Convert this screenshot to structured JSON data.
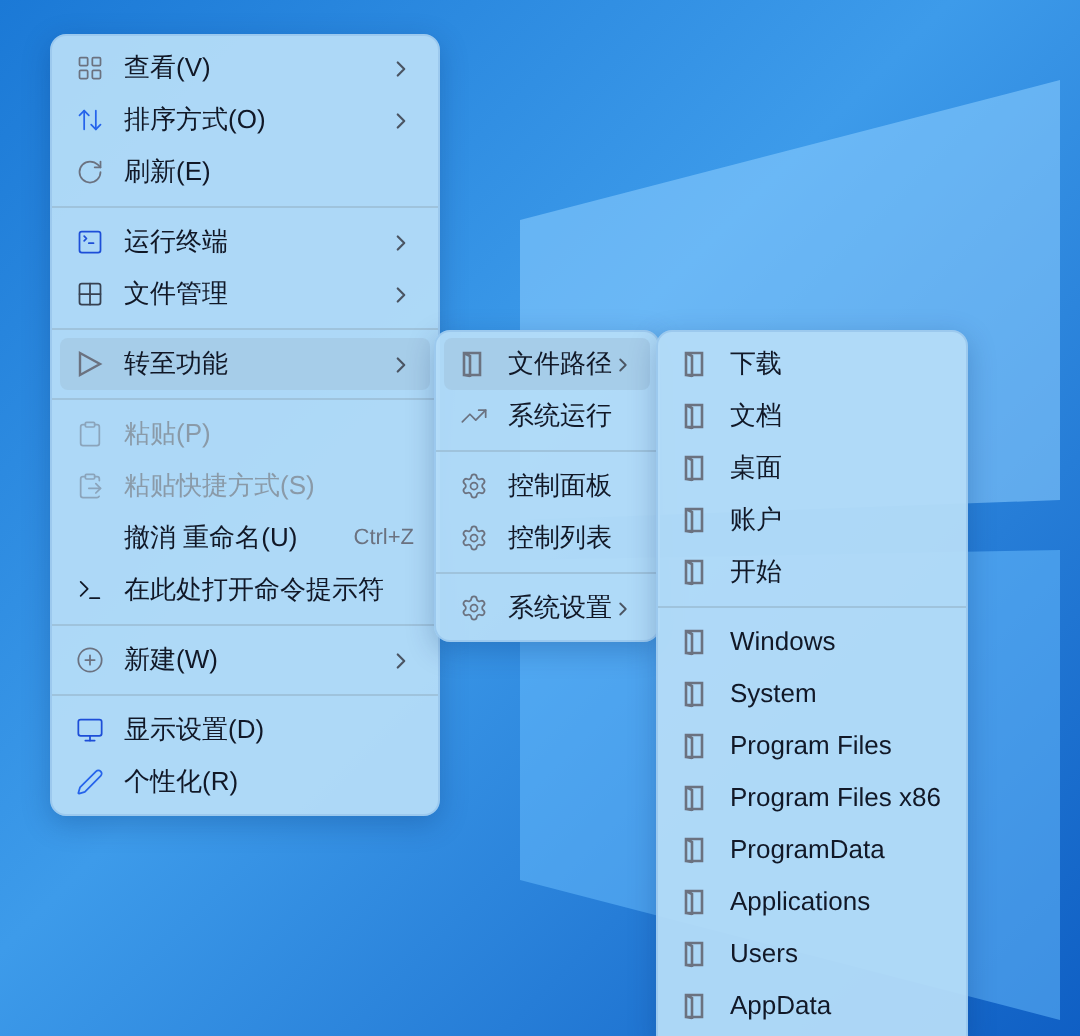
{
  "main_menu": {
    "items": [
      {
        "kind": "item",
        "label": "查看(V)",
        "has_submenu": true,
        "disabled": false,
        "selected": false
      },
      {
        "kind": "item",
        "label": "排序方式(O)",
        "has_submenu": true,
        "disabled": false,
        "selected": false
      },
      {
        "kind": "item",
        "label": "刷新(E)",
        "has_submenu": false,
        "disabled": false,
        "selected": false
      },
      {
        "kind": "separator"
      },
      {
        "kind": "item",
        "label": "运行终端",
        "has_submenu": true,
        "disabled": false,
        "selected": false
      },
      {
        "kind": "item",
        "label": "文件管理",
        "has_submenu": true,
        "disabled": false,
        "selected": false
      },
      {
        "kind": "separator"
      },
      {
        "kind": "item",
        "label": "转至功能",
        "has_submenu": true,
        "disabled": false,
        "selected": true
      },
      {
        "kind": "separator"
      },
      {
        "kind": "item",
        "label": "粘贴(P)",
        "has_submenu": false,
        "disabled": true,
        "selected": false
      },
      {
        "kind": "item",
        "label": "粘贴快捷方式(S)",
        "has_submenu": false,
        "disabled": true,
        "selected": false
      },
      {
        "kind": "item",
        "label": "撤消 重命名(U)",
        "shortcut": "Ctrl+Z",
        "has_submenu": false,
        "disabled": false,
        "selected": false
      },
      {
        "kind": "item",
        "label": "在此处打开命令提示符",
        "has_submenu": false,
        "disabled": false,
        "selected": false
      },
      {
        "kind": "separator"
      },
      {
        "kind": "item",
        "label": "新建(W)",
        "has_submenu": true,
        "disabled": false,
        "selected": false
      },
      {
        "kind": "separator"
      },
      {
        "kind": "item",
        "label": "显示设置(D)",
        "has_submenu": false,
        "disabled": false,
        "selected": false
      },
      {
        "kind": "item",
        "label": "个性化(R)",
        "has_submenu": false,
        "disabled": false,
        "selected": false
      }
    ]
  },
  "goto_menu": {
    "items": [
      {
        "kind": "item",
        "label": "文件路径",
        "has_submenu": true,
        "disabled": false,
        "selected": true
      },
      {
        "kind": "item",
        "label": "系统运行",
        "has_submenu": false,
        "disabled": false,
        "selected": false
      },
      {
        "kind": "separator"
      },
      {
        "kind": "item",
        "label": "控制面板",
        "has_submenu": false,
        "disabled": false,
        "selected": false
      },
      {
        "kind": "item",
        "label": "控制列表",
        "has_submenu": false,
        "disabled": false,
        "selected": false
      },
      {
        "kind": "separator"
      },
      {
        "kind": "item",
        "label": "系统设置",
        "has_submenu": true,
        "disabled": false,
        "selected": false
      }
    ]
  },
  "path_menu": {
    "items": [
      {
        "kind": "item",
        "label": "下载",
        "has_submenu": false,
        "disabled": false,
        "selected": false
      },
      {
        "kind": "item",
        "label": "文档",
        "has_submenu": false,
        "disabled": false,
        "selected": false
      },
      {
        "kind": "item",
        "label": "桌面",
        "has_submenu": false,
        "disabled": false,
        "selected": false
      },
      {
        "kind": "item",
        "label": "账户",
        "has_submenu": false,
        "disabled": false,
        "selected": false
      },
      {
        "kind": "item",
        "label": "开始",
        "has_submenu": false,
        "disabled": false,
        "selected": false
      },
      {
        "kind": "separator"
      },
      {
        "kind": "item",
        "label": "Windows",
        "has_submenu": false,
        "disabled": false,
        "selected": false
      },
      {
        "kind": "item",
        "label": "System",
        "has_submenu": false,
        "disabled": false,
        "selected": false
      },
      {
        "kind": "item",
        "label": "Program Files",
        "has_submenu": false,
        "disabled": false,
        "selected": false
      },
      {
        "kind": "item",
        "label": "Program Files x86",
        "disabled": false,
        "selected": false
      },
      {
        "kind": "item",
        "label": "ProgramData",
        "has_submenu": false,
        "disabled": false,
        "selected": false
      },
      {
        "kind": "item",
        "label": "Applications",
        "has_submenu": false,
        "disabled": false,
        "selected": false
      },
      {
        "kind": "item",
        "label": "Users",
        "has_submenu": false,
        "disabled": false,
        "selected": false
      },
      {
        "kind": "item",
        "label": "AppData",
        "has_submenu": false,
        "disabled": false,
        "selected": false
      }
    ]
  }
}
